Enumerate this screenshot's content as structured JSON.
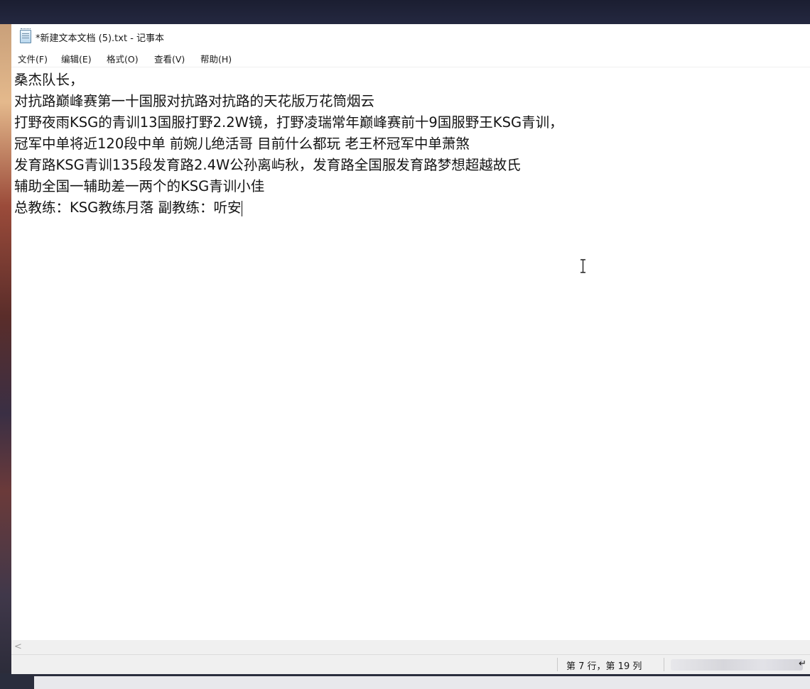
{
  "window": {
    "title": "*新建文本文档 (5).txt - 记事本"
  },
  "menu": [
    {
      "label": "文件(F)"
    },
    {
      "label": "编辑(E)"
    },
    {
      "label": "格式(O)"
    },
    {
      "label": "查看(V)"
    },
    {
      "label": "帮助(H)"
    }
  ],
  "editor": {
    "lines": [
      "桑杰队长，",
      "对抗路巅峰赛第一十国服对抗路对抗路的天花版万花筒烟云",
      "打野夜雨KSG的青训13国服打野2.2W镜，打野凌瑞常年巅峰赛前十9国服野王KSG青训，",
      "冠军中单将近120段中单 前婉儿绝活哥 目前什么都玩 老王杯冠军中单萧煞",
      "发育路KSG青训135段发育路2.4W公孙离屿秋，发育路全国服发育路梦想超越故氏",
      "辅助全国一辅助差一两个的KSG青训小佳",
      "总教练：KSG教练月落 副教练：听安"
    ]
  },
  "statusbar": {
    "position": "第 7 行，第 19 列",
    "tail": "↵"
  },
  "icons": {
    "app": "notepad-icon",
    "scroll_left": "scroll-left-arrow-icon",
    "cursor": "text-ibeam-cursor-icon"
  }
}
